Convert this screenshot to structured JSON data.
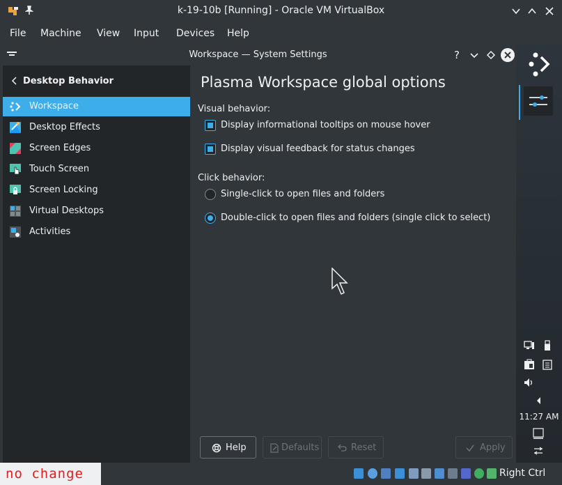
{
  "vbox": {
    "title": "k-19-10b [Running] - Oracle VM VirtualBox",
    "menu": [
      "File",
      "Machine",
      "View",
      "Input",
      "Devices",
      "Help"
    ],
    "host_key": "Right Ctrl"
  },
  "settings": {
    "window_title": "Workspace — System Settings",
    "help_glyph": "?",
    "sidebar": {
      "back_label": "Desktop Behavior",
      "items": [
        {
          "label": "Workspace",
          "icon": "workspace-icon",
          "active": true
        },
        {
          "label": "Desktop Effects",
          "icon": "desktop-effects-icon",
          "active": false
        },
        {
          "label": "Screen Edges",
          "icon": "screen-edges-icon",
          "active": false
        },
        {
          "label": "Touch Screen",
          "icon": "touch-screen-icon",
          "active": false
        },
        {
          "label": "Screen Locking",
          "icon": "screen-locking-icon",
          "active": false
        },
        {
          "label": "Virtual Desktops",
          "icon": "virtual-desktops-icon",
          "active": false
        },
        {
          "label": "Activities",
          "icon": "activities-icon",
          "active": false
        }
      ]
    },
    "page": {
      "title": "Plasma Workspace global options",
      "visual_label": "Visual behavior:",
      "visual_options": [
        {
          "label": "Display informational tooltips on mouse hover",
          "checked": true
        },
        {
          "label": "Display visual feedback for status changes",
          "checked": true
        }
      ],
      "click_label": "Click behavior:",
      "click_options": [
        {
          "label": "Single-click to open files and folders",
          "selected": false
        },
        {
          "label": "Double-click to open files and folders (single click to select)",
          "selected": true
        }
      ]
    },
    "buttons": {
      "help": "Help",
      "defaults": "Defaults",
      "reset": "Reset",
      "apply": "Apply"
    }
  },
  "panel": {
    "clock": "11:27 AM"
  },
  "annotation": {
    "text": "no change"
  },
  "colors": {
    "accent": "#3daee9",
    "window_bg": "#31363b",
    "sidebar_bg": "#232629",
    "annotation_text": "#e02020"
  }
}
